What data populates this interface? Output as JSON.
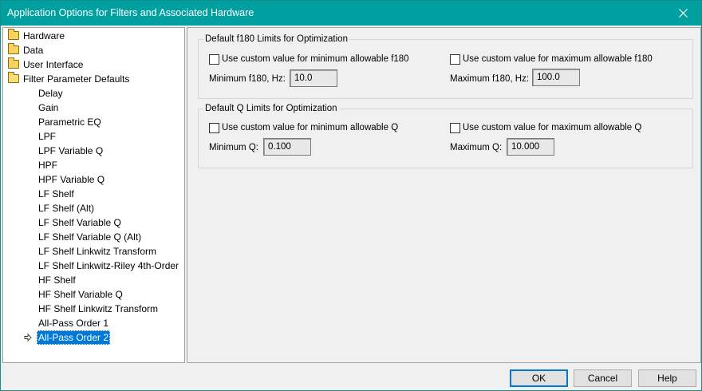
{
  "window": {
    "title": "Application Options for Filters and Associated Hardware"
  },
  "tree": {
    "folders": [
      {
        "label": "Hardware"
      },
      {
        "label": "Data"
      },
      {
        "label": "User Interface"
      },
      {
        "label": "Filter Parameter Defaults"
      }
    ],
    "children": [
      {
        "label": "Delay"
      },
      {
        "label": "Gain"
      },
      {
        "label": "Parametric EQ"
      },
      {
        "label": "LPF"
      },
      {
        "label": "LPF Variable Q"
      },
      {
        "label": "HPF"
      },
      {
        "label": "HPF Variable Q"
      },
      {
        "label": "LF Shelf"
      },
      {
        "label": "LF Shelf (Alt)"
      },
      {
        "label": "LF Shelf Variable Q"
      },
      {
        "label": "LF Shelf Variable Q (Alt)"
      },
      {
        "label": "LF Shelf Linkwitz Transform"
      },
      {
        "label": "LF Shelf Linkwitz-Riley 4th-Order"
      },
      {
        "label": "HF Shelf"
      },
      {
        "label": "HF Shelf Variable Q"
      },
      {
        "label": "HF Shelf Linkwitz Transform"
      },
      {
        "label": "All-Pass Order 1"
      },
      {
        "label": "All-Pass Order 2"
      }
    ],
    "selected": "All-Pass Order 2"
  },
  "f180_group": {
    "title": "Default f180 Limits for Optimization",
    "min_checkbox": "Use custom value for minimum allowable f180",
    "max_checkbox": "Use custom value for maximum allowable f180",
    "min_label": "Minimum f180, Hz:",
    "min_value": "10.0",
    "max_label": "Maximum f180, Hz:",
    "max_value": "100.0"
  },
  "q_group": {
    "title": "Default Q Limits for Optimization",
    "min_checkbox": "Use custom value for minimum allowable Q",
    "max_checkbox": "Use custom value for maximum allowable Q",
    "min_label": "Minimum Q:",
    "min_value": "0.100",
    "max_label": "Maximum Q:",
    "max_value": "10.000"
  },
  "buttons": {
    "ok": "OK",
    "cancel": "Cancel",
    "help": "Help"
  }
}
